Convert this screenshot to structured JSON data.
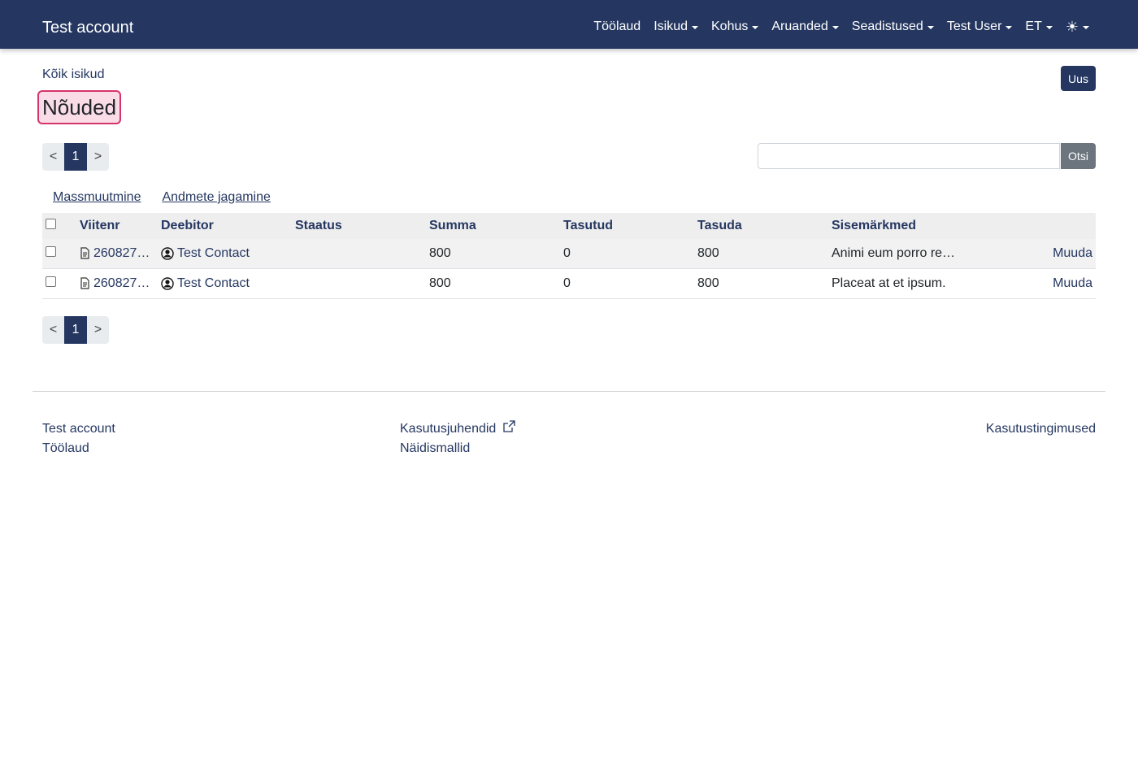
{
  "navbar": {
    "brand": "Test account",
    "items": [
      {
        "label": "Töölaud",
        "dropdown": false
      },
      {
        "label": "Isikud",
        "dropdown": true
      },
      {
        "label": "Kohus",
        "dropdown": true
      },
      {
        "label": "Aruanded",
        "dropdown": true
      },
      {
        "label": "Seadistused",
        "dropdown": true
      },
      {
        "label": "Test User",
        "dropdown": true
      },
      {
        "label": "ET",
        "dropdown": true
      }
    ],
    "theme_icon": "sun-icon"
  },
  "breadcrumb": "Kõik isikud",
  "new_button": "Uus",
  "page_title": "Nõuded",
  "pager": {
    "prev": "<",
    "current": "1",
    "next": ">"
  },
  "search": {
    "placeholder": "",
    "button": "Otsi"
  },
  "actions": {
    "mass_edit": "Massmuutmine",
    "share": "Andmete jagamine"
  },
  "table": {
    "headers": [
      "Viitenr",
      "Deebitor",
      "Staatus",
      "Summa",
      "Tasutud",
      "Tasuda",
      "Sisemärkmed"
    ],
    "rows": [
      {
        "ref": "260827…",
        "debtor": "Test Contact",
        "status": "",
        "sum": "800",
        "paid": "0",
        "due": "800",
        "notes": "Animi eum porro re…",
        "edit": "Muuda"
      },
      {
        "ref": "260827…",
        "debtor": "Test Contact",
        "status": "",
        "sum": "800",
        "paid": "0",
        "due": "800",
        "notes": "Placeat at et ipsum.",
        "edit": "Muuda"
      }
    ]
  },
  "footer": {
    "col1": [
      "Test account",
      "Töölaud"
    ],
    "col2": [
      "Kasutusjuhendid",
      "Näidismallid"
    ],
    "col3": [
      "Kasutustingimused"
    ]
  }
}
